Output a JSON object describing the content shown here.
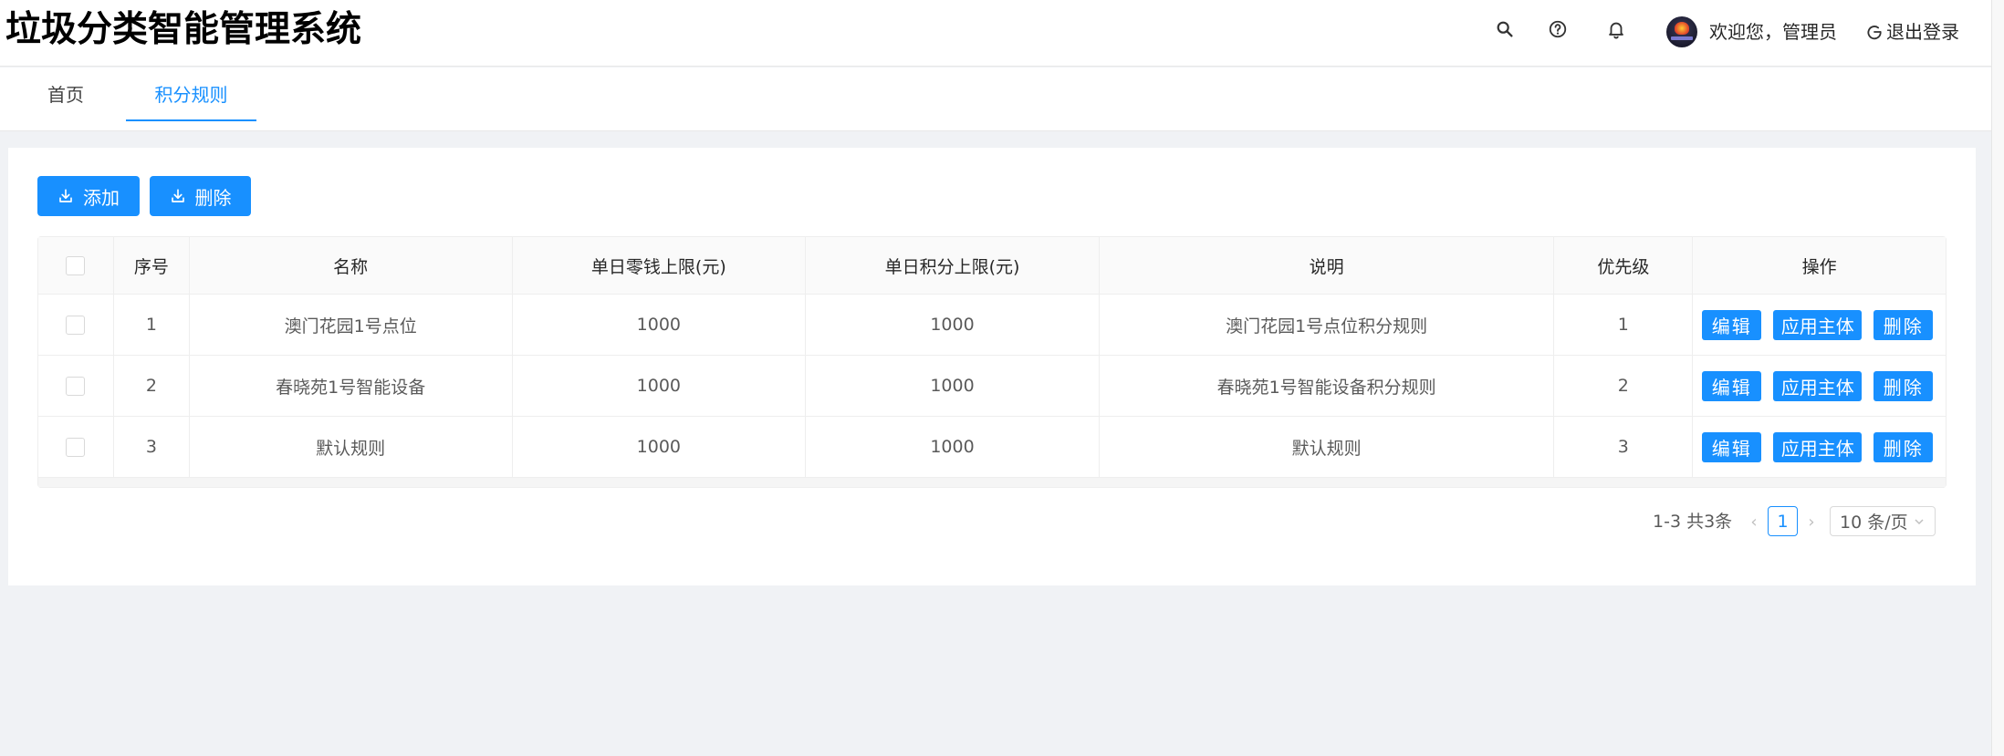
{
  "header": {
    "title": "垃圾分类智能管理系统",
    "icons": [
      "search-icon",
      "question-icon",
      "bell-icon"
    ],
    "welcome": "欢迎您，管理员",
    "logout": "退出登录"
  },
  "tabs": [
    {
      "label": "首页",
      "active": false
    },
    {
      "label": "积分规则",
      "active": true
    }
  ],
  "toolbar": {
    "add_label": "添加",
    "delete_label": "删除"
  },
  "table": {
    "columns": [
      "序号",
      "名称",
      "单日零钱上限(元)",
      "单日积分上限(元)",
      "说明",
      "优先级",
      "操作"
    ],
    "rows": [
      {
        "idx": "1",
        "name": "澳门花园1号点位",
        "cash_limit": "1000",
        "points_limit": "1000",
        "desc": "澳门花园1号点位积分规则",
        "priority": "1"
      },
      {
        "idx": "2",
        "name": "春晓苑1号智能设备",
        "cash_limit": "1000",
        "points_limit": "1000",
        "desc": "春晓苑1号智能设备积分规则",
        "priority": "2"
      },
      {
        "idx": "3",
        "name": "默认规则",
        "cash_limit": "1000",
        "points_limit": "1000",
        "desc": "默认规则",
        "priority": "3"
      }
    ],
    "row_actions": {
      "edit": "编辑",
      "apply": "应用主体",
      "delete": "删除"
    }
  },
  "pagination": {
    "total_text": "1-3 共3条",
    "current_page": "1",
    "page_size": "10 条/页"
  },
  "colors": {
    "primary": "#1890ff",
    "background": "#f0f2f5"
  }
}
